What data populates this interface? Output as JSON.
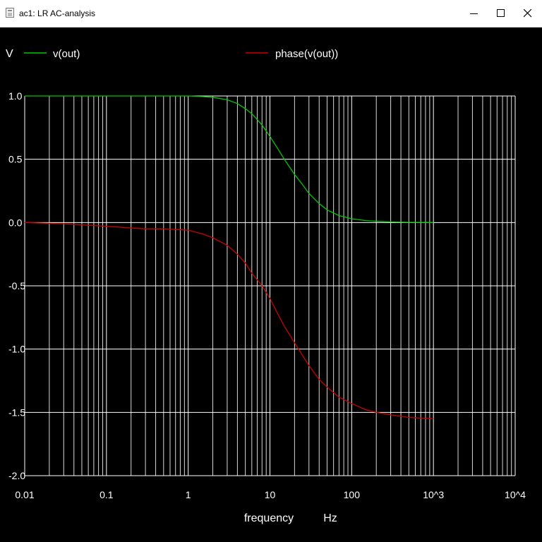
{
  "window": {
    "title": "ac1: LR AC-analysis",
    "controls": {
      "minimize_icon": "minimize-icon",
      "maximize_icon": "maximize-icon",
      "close_icon": "close-icon"
    }
  },
  "colors": {
    "background": "#000000",
    "grid": "#ffffff",
    "text": "#ffffff",
    "vout": "#00c800",
    "phase": "#c80000"
  },
  "chart_data": {
    "type": "line",
    "ylabel": "V",
    "xlabel": "frequency",
    "xunit": "Hz",
    "xscale": "log",
    "xlim": [
      0.01,
      10000
    ],
    "ylim": [
      -2.0,
      1.0
    ],
    "grid": true,
    "legend": "top",
    "x_tick_labels": [
      "0.01",
      "0.1",
      "1",
      "10",
      "100",
      "10^3",
      "10^4"
    ],
    "y_tick_labels": [
      "1.0",
      "0.5",
      "0.0",
      "-0.5",
      "-1.0",
      "-1.5",
      "-2.0"
    ],
    "series": [
      {
        "name": "v(out)",
        "color": "#00c800",
        "x": [
          0.01,
          0.1,
          0.5,
          1,
          1.5,
          2,
          3,
          4,
          5,
          6,
          8,
          10,
          12,
          15,
          20,
          25,
          30,
          40,
          50,
          70,
          100,
          150,
          200,
          300,
          500,
          1000
        ],
        "y": [
          1.0,
          1.0,
          1.0,
          1.0,
          0.995,
          0.99,
          0.97,
          0.94,
          0.9,
          0.86,
          0.77,
          0.68,
          0.6,
          0.5,
          0.38,
          0.3,
          0.23,
          0.15,
          0.1,
          0.055,
          0.03,
          0.015,
          0.01,
          0.005,
          0.002,
          0.001
        ]
      },
      {
        "name": "phase(v(out))",
        "color": "#c80000",
        "x": [
          0.01,
          0.03,
          0.1,
          0.3,
          0.5,
          1,
          1.5,
          2,
          3,
          4,
          5,
          6,
          8,
          10,
          12,
          15,
          20,
          25,
          30,
          40,
          50,
          70,
          100,
          150,
          200,
          300,
          500,
          1000
        ],
        "y": [
          0.0,
          -0.01,
          -0.03,
          -0.05,
          -0.05,
          -0.06,
          -0.09,
          -0.12,
          -0.18,
          -0.25,
          -0.32,
          -0.4,
          -0.5,
          -0.6,
          -0.7,
          -0.82,
          -0.95,
          -1.05,
          -1.13,
          -1.24,
          -1.3,
          -1.38,
          -1.43,
          -1.48,
          -1.5,
          -1.52,
          -1.54,
          -1.55
        ]
      }
    ]
  }
}
